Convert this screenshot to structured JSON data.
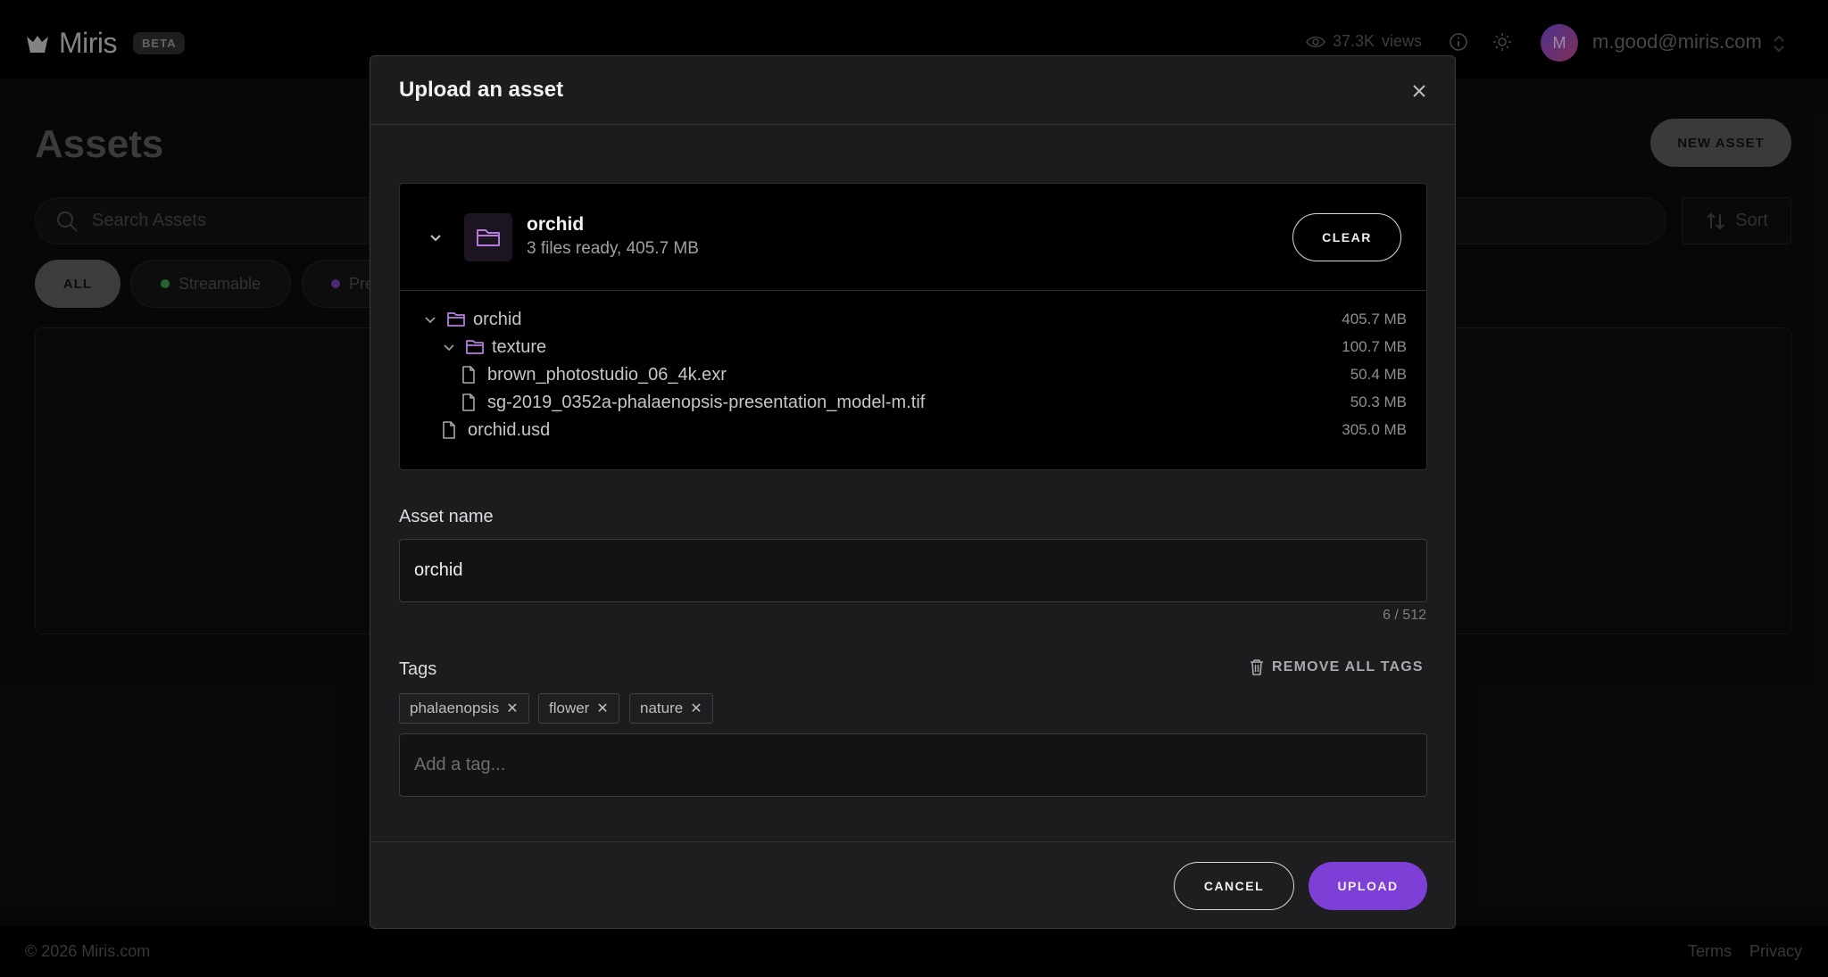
{
  "app": {
    "name": "Miris",
    "badge": "BETA",
    "views_count": "37.3K",
    "views_label": "views",
    "user_initial": "M",
    "user_email": "m.good@miris.com"
  },
  "assets_page": {
    "title": "Assets",
    "new_asset_label": "NEW ASSET",
    "search_placeholder": "Search Assets",
    "sort_label": "Sort",
    "filters": [
      {
        "label": "ALL",
        "active": true
      },
      {
        "label": "Streamable",
        "dot_color": "#3a9a4a"
      },
      {
        "label": "Pre",
        "dot_color": "#7a3fb8"
      }
    ]
  },
  "footer": {
    "copyright": "© 2026 Miris.com",
    "links": [
      "Terms",
      "Privacy"
    ]
  },
  "modal": {
    "title": "Upload an asset",
    "folder": {
      "name": "orchid",
      "summary": "3 files ready, 405.7 MB",
      "clear_label": "CLEAR"
    },
    "tree": [
      {
        "name": "orchid",
        "size": "405.7 MB",
        "type": "folder"
      },
      {
        "name": "texture",
        "size": "100.7 MB",
        "type": "folder"
      },
      {
        "name": "brown_photostudio_06_4k.exr",
        "size": "50.4 MB",
        "type": "file"
      },
      {
        "name": "sg-2019_0352a-phalaenopsis-presentation_model-m.tif",
        "size": "50.3 MB",
        "type": "file"
      },
      {
        "name": "orchid.usd",
        "size": "305.0 MB",
        "type": "file"
      }
    ],
    "asset_name_label": "Asset name",
    "asset_name_value": "orchid",
    "asset_name_counter": "6 / 512",
    "tags_label": "Tags",
    "remove_all_label": "REMOVE ALL TAGS",
    "tags": [
      {
        "label": "phalaenopsis"
      },
      {
        "label": "flower"
      },
      {
        "label": "nature"
      }
    ],
    "tag_placeholder": "Add a tag...",
    "cancel_label": "CANCEL",
    "upload_label": "UPLOAD"
  },
  "colors": {
    "accent": "#7e3fd6",
    "folder_icon": "#b57bdb"
  },
  "icons": [
    "miris-logo-icon",
    "eye-icon",
    "info-icon",
    "sun-icon",
    "chevron-updown-icon",
    "search-icon",
    "sort-icon",
    "close-icon",
    "chevron-down-icon",
    "folder-icon",
    "file-icon",
    "trash-icon"
  ]
}
